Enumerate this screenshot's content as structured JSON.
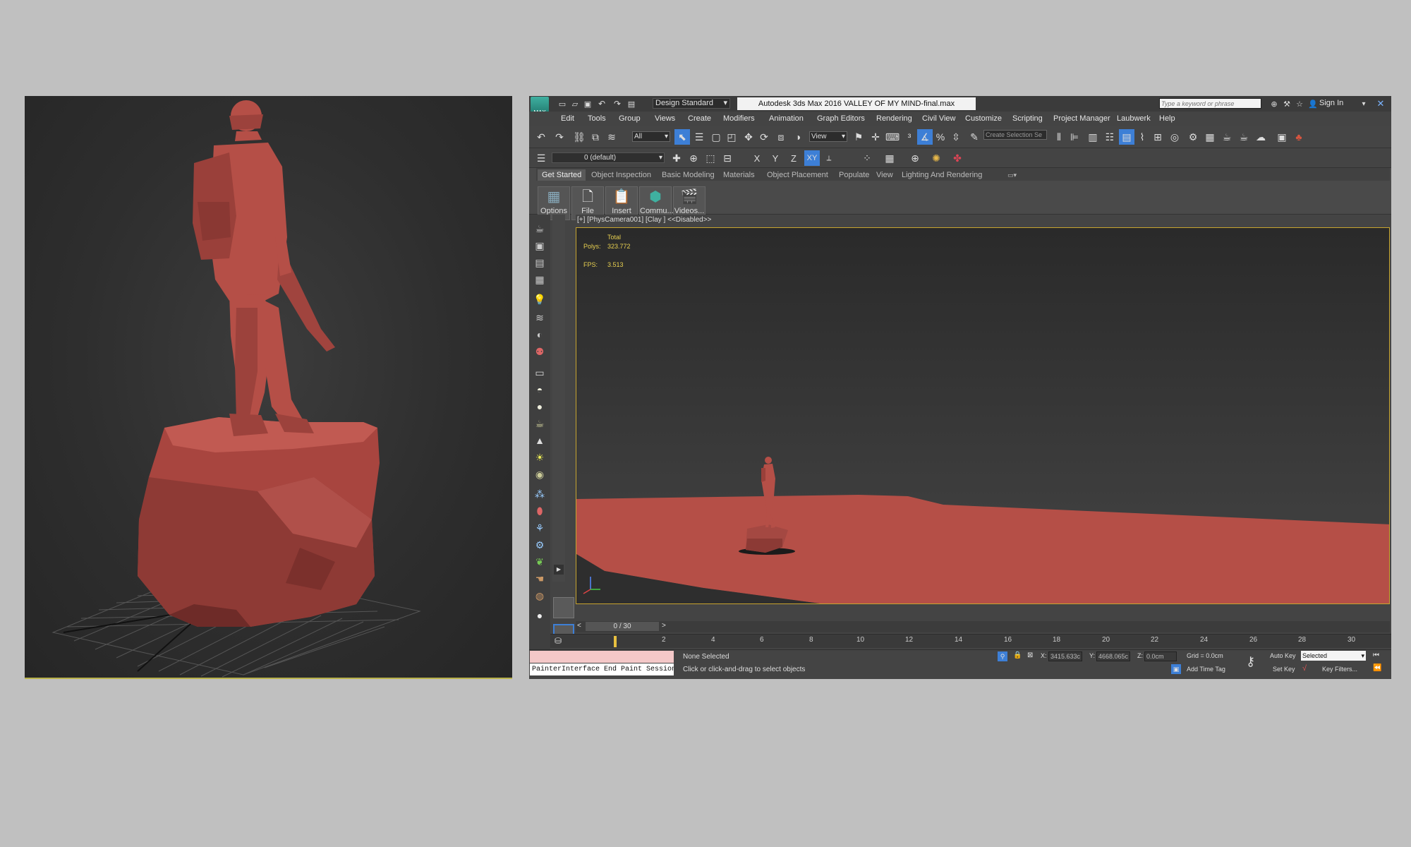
{
  "app": {
    "logo_label": "MAX",
    "workspace": "Design Standard",
    "title": "Autodesk 3ds Max 2016      VALLEY OF MY MIND-final.max",
    "search_placeholder": "Type a keyword or phrase",
    "sign_in": "Sign In"
  },
  "menu": [
    "Edit",
    "Tools",
    "Group",
    "Views",
    "Create",
    "Modifiers",
    "Animation",
    "Graph Editors",
    "Rendering",
    "Civil View",
    "Customize",
    "Scripting",
    "Project Manager",
    "Laubwerk",
    "Help"
  ],
  "toolbar": {
    "selection_filter": "All",
    "ref_coord": "View",
    "named_selection_placeholder": "Create Selection Se",
    "layer": "0 (default)",
    "axes": [
      "X",
      "Y",
      "Z",
      "XY"
    ]
  },
  "ribbon": {
    "tabs": [
      "Get Started",
      "Object Inspection",
      "Basic Modeling",
      "Materials",
      "Object Placement",
      "Populate",
      "View",
      "Lighting And Rendering"
    ],
    "buttons": [
      {
        "label": "Options",
        "icon": "options-icon"
      },
      {
        "label": "File",
        "icon": "file-icon"
      },
      {
        "label": "Insert",
        "icon": "insert-icon"
      },
      {
        "label": "Commu...",
        "icon": "community-icon"
      },
      {
        "label": "Videos...",
        "icon": "videos-icon"
      }
    ]
  },
  "viewport": {
    "label": "[+] [PhysCamera001] [Clay ]  <<Disabled>>",
    "stats_total": "Total",
    "polys_label": "Polys:",
    "polys_value": "323.772",
    "fps_label": "FPS:",
    "fps_value": "3.513"
  },
  "timeline": {
    "frame": "0 / 30",
    "ticks": [
      "2",
      "4",
      "6",
      "8",
      "10",
      "12",
      "14",
      "16",
      "18",
      "20",
      "22",
      "24",
      "26",
      "28",
      "30"
    ]
  },
  "status": {
    "maxscript": "PainterInterface End Paint Session",
    "selection": "None Selected",
    "prompt": "Click or click-and-drag to select objects",
    "x_label": "X:",
    "x_value": "3415.633c",
    "y_label": "Y:",
    "y_value": "4668.065c",
    "z_label": "Z:",
    "z_value": "0.0cm",
    "grid": "Grid = 0.0cm",
    "add_time_tag": "Add Time Tag",
    "auto_key": "Auto Key",
    "set_key": "Set Key",
    "key_mode": "Selected",
    "key_filters": "Key Filters..."
  },
  "colors": {
    "clay": "#b54f47",
    "viewport_border": "#c7a42e",
    "accent_blue": "#3d7fd6"
  }
}
